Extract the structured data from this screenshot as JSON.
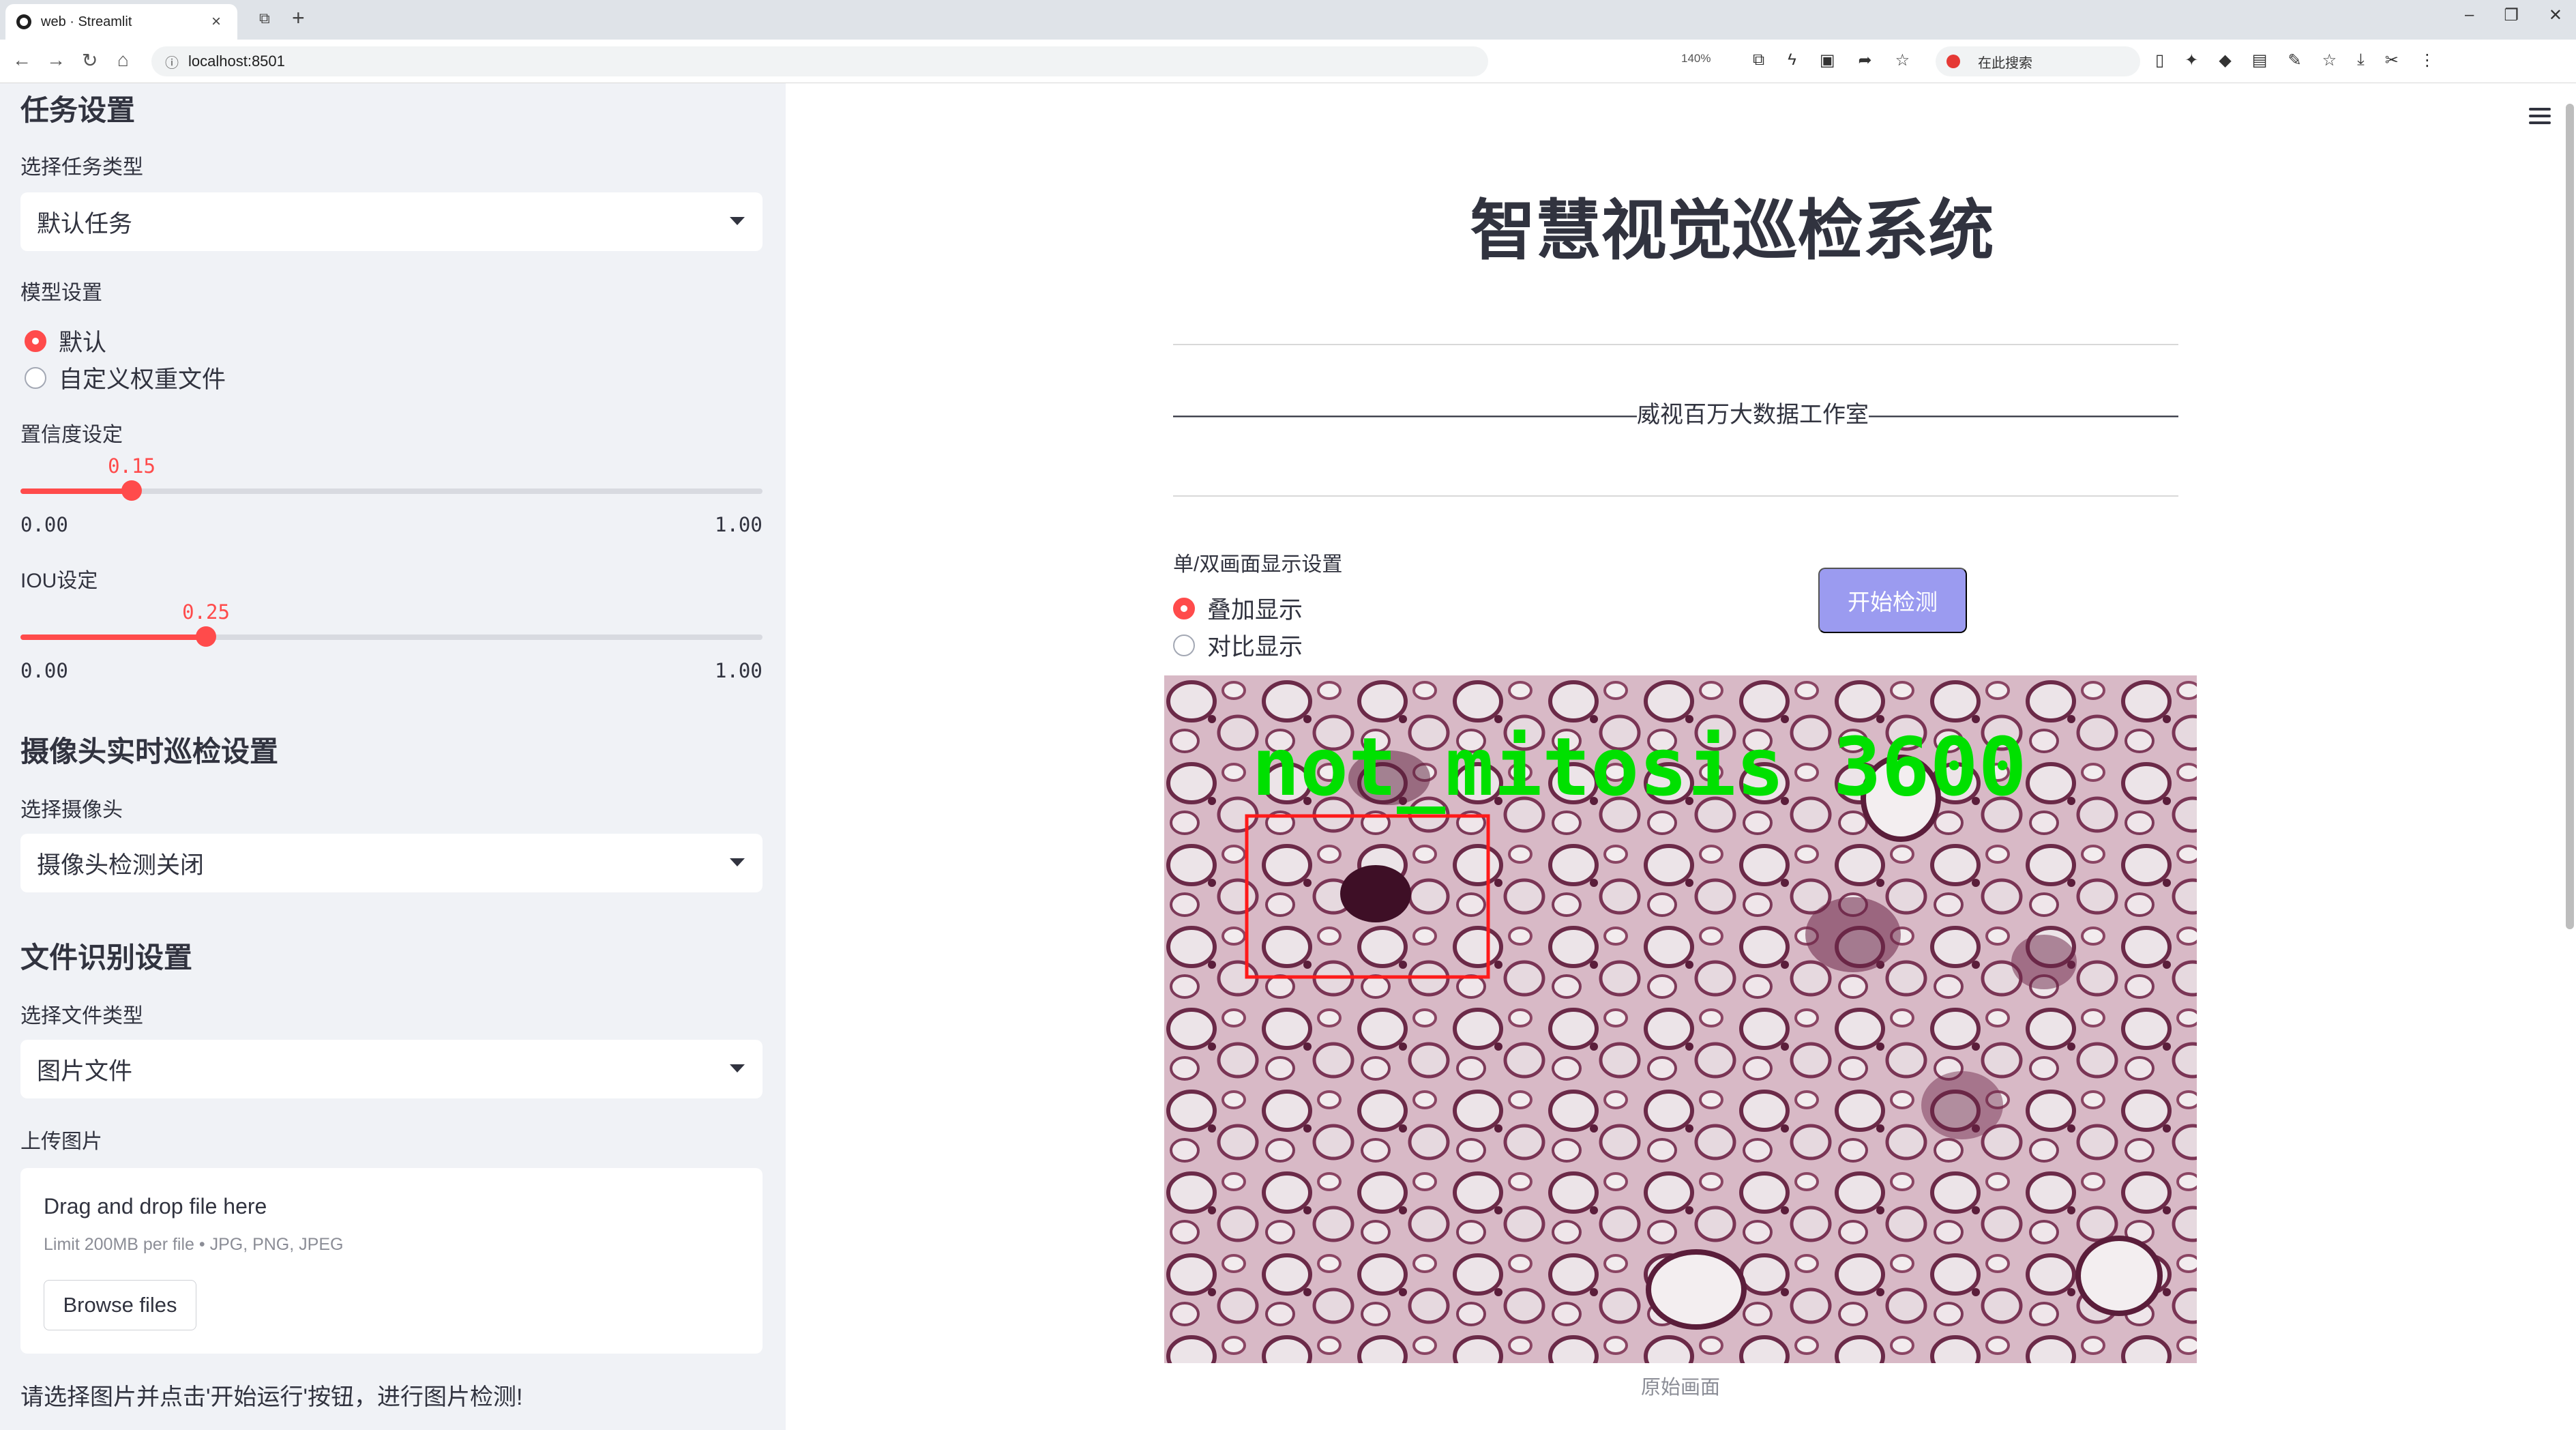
{
  "browser": {
    "tab_title": "web · Streamlit",
    "url": "localhost:8501",
    "zoom": "140%",
    "search_placeholder": "在此搜索"
  },
  "sidebar": {
    "task_section": {
      "heading": "任务设置",
      "task_type_label": "选择任务类型",
      "task_type_value": "默认任务"
    },
    "model_section": {
      "label": "模型设置",
      "options": [
        "默认",
        "自定义权重文件"
      ],
      "selected": "默认"
    },
    "confidence": {
      "label": "置信度设定",
      "value": "0.15",
      "value_num": 0.15,
      "min": "0.00",
      "max": "1.00"
    },
    "iou": {
      "label": "IOU设定",
      "value": "0.25",
      "value_num": 0.25,
      "min": "0.00",
      "max": "1.00"
    },
    "camera_section": {
      "heading": "摄像头实时巡检设置",
      "label": "选择摄像头",
      "value": "摄像头检测关闭"
    },
    "file_section": {
      "heading": "文件识别设置",
      "file_type_label": "选择文件类型",
      "file_type_value": "图片文件",
      "upload_label": "上传图片",
      "drop_title": "Drag and drop file here",
      "drop_limit": "Limit 200MB per file • JPG, PNG, JPEG",
      "browse_label": "Browse files"
    },
    "note": "请选择图片并点击'开始运行'按钮，进行图片检测!"
  },
  "main": {
    "title": "智慧视觉巡检系统",
    "studio_line": "————————————————————威视百万大数据工作室——————————————————————",
    "display_setting_label": "单/双画面显示设置",
    "display_options": [
      "叠加显示",
      "对比显示"
    ],
    "display_selected": "叠加显示",
    "start_button": "开始检测",
    "detection_label": "not_mitosis  3600",
    "image_caption": "原始画面"
  },
  "colors": {
    "accent": "#ff4b4b",
    "sidebar_bg": "#f0f2f6",
    "button_disabled": "#9b9bf0",
    "detection_box": "#ff1a1a",
    "detection_text": "#00e000"
  }
}
